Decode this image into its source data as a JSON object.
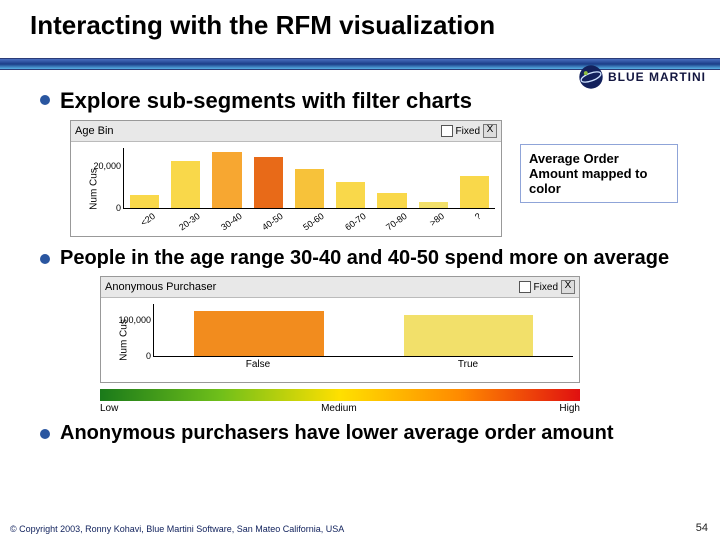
{
  "title": "Interacting with the RFM visualization",
  "logo_text": "BLUE MARTINI",
  "bullets": [
    "Explore sub-segments with filter charts",
    "People in the age range 30-40 and 40-50 spend more on average",
    "Anonymous purchasers have lower average order amount"
  ],
  "callout": "Average Order Amount mapped to color",
  "footer": "© Copyright 2003, Ronny Kohavi, Blue Martini Software, San Mateo California, USA",
  "page": "54",
  "chart1": {
    "title": "Age Bin",
    "ylabel": "Num Cus",
    "ytick": "20,000",
    "zero": "0",
    "fixed_label": "Fixed",
    "close": "X"
  },
  "chart2": {
    "title": "Anonymous Purchaser",
    "ylabel": "Num Cus",
    "ytick": "100,000",
    "zero": "0",
    "fixed_label": "Fixed",
    "close": "X",
    "cat_false": "False",
    "cat_true": "True",
    "grad_low": "Low",
    "grad_med": "Medium",
    "grad_high": "High"
  },
  "chart_data": [
    {
      "type": "bar",
      "title": "Age Bin",
      "xlabel": "",
      "ylabel": "Num Cus",
      "ylim": [
        0,
        28000
      ],
      "categories": [
        "<20",
        "20-30",
        "30-40",
        "40-50",
        "50-60",
        "60-70",
        "70-80",
        ">80",
        "?"
      ],
      "series": [
        {
          "name": "Num Cus",
          "values": [
            6000,
            22000,
            26000,
            24000,
            18000,
            12000,
            7000,
            3000,
            15000
          ]
        },
        {
          "name": "Avg Order Amount (color)",
          "values": [
            "low-mid",
            "low-mid",
            "mid-high",
            "high",
            "mid",
            "low-mid",
            "low-mid",
            "low",
            "low-mid"
          ]
        }
      ],
      "bar_colors": [
        "#f9d84a",
        "#f9d84a",
        "#f7a731",
        "#e86a18",
        "#f7c23a",
        "#f9d84a",
        "#f9d84a",
        "#f2e06a",
        "#f9d84a"
      ]
    },
    {
      "type": "bar",
      "title": "Anonymous Purchaser",
      "xlabel": "",
      "ylabel": "Num Cus",
      "ylim": [
        0,
        140000
      ],
      "categories": [
        "False",
        "True"
      ],
      "series": [
        {
          "name": "Num Cus",
          "values": [
            120000,
            110000
          ]
        },
        {
          "name": "Avg Order Amount (color)",
          "values": [
            "high",
            "low-mid"
          ]
        }
      ],
      "bar_colors": [
        "#f28c1e",
        "#f2e06a"
      ],
      "legend_gradient": {
        "low": "green",
        "high": "red",
        "label_low": "Low",
        "label_mid": "Medium",
        "label_high": "High"
      }
    }
  ]
}
